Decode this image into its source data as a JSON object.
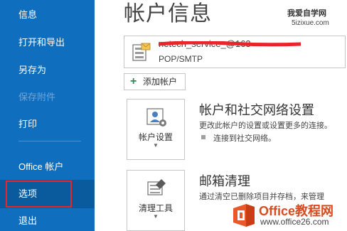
{
  "sidebar": {
    "items": [
      {
        "label": "信息"
      },
      {
        "label": "打开和导出"
      },
      {
        "label": "另存为"
      },
      {
        "label": "保存附件"
      },
      {
        "label": "打印"
      },
      {
        "label": "Office 帐户"
      },
      {
        "label": "选项"
      },
      {
        "label": "退出"
      }
    ]
  },
  "main": {
    "title": "帐户信息",
    "account": {
      "email": "netech_service_@163",
      "type": "POP/SMTP"
    },
    "add_account_label": "添加帐户",
    "account_settings": {
      "tile_label": "帐户设置",
      "title": "帐户和社交网络设置",
      "description": "更改此帐户的设置或设置更多的连接。",
      "bullet": "连接到社交网络。"
    },
    "mailbox_cleanup": {
      "tile_label": "清理工具",
      "title": "邮箱清理",
      "description": "通过清空已删除项目并存档，来管理"
    }
  },
  "watermarks": {
    "top_line1": "我爱自学网",
    "top_line2": "5izixue.com",
    "logo_text": "Office教程网",
    "logo_url": "www.office26.com"
  },
  "colors": {
    "sidebar": "#106ebe",
    "selected_outline": "#e8262a",
    "redaction": "#e8262a",
    "logo_orange": "#d94b1e"
  },
  "icons": {
    "account": "mail-account-icon",
    "add": "plus-icon",
    "account_settings": "account-settings-icon",
    "cleanup": "cleanup-tools-icon",
    "logo": "office-logo-icon"
  }
}
